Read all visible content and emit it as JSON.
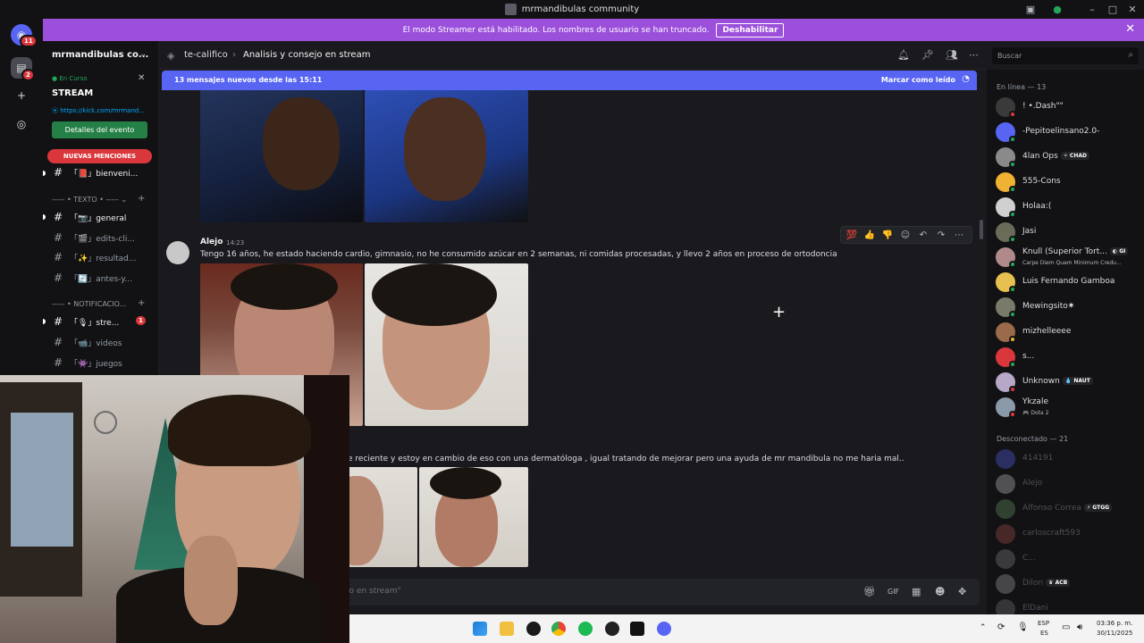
{
  "window": {
    "title": "mrmandibulas community",
    "controls": [
      "–",
      "□",
      "✕"
    ]
  },
  "streamer_banner": {
    "text": "El modo Streamer está habilitado. Los nombres de usuario se han truncado.",
    "button": "Deshabilitar"
  },
  "rail": {
    "badge_top": "11",
    "badge_second": "2"
  },
  "sidebar": {
    "server_name": "mrmandibulas co...",
    "event": {
      "status": "En Curso",
      "title": "STREAM",
      "link": "https://kick.com/mrmand...",
      "button": "Detalles del evento"
    },
    "mentions_label": "NUEVAS MENCIONES",
    "channels_top": [
      {
        "label": "「📕」bienveni..."
      }
    ],
    "category_text": "----- • TEXTO • -----",
    "text_channels": [
      {
        "label": "「📷」general"
      },
      {
        "label": "「🎬」edits-cli..."
      },
      {
        "label": "「✨」resultad..."
      },
      {
        "label": "「🔄」antes-y..."
      }
    ],
    "category_notif": "----- • NOTIFICACIO...",
    "notif_channels": [
      {
        "label": "「🎙」stre...",
        "badge": "1"
      },
      {
        "label": "「📹」videos"
      },
      {
        "label": "「👾」juegos"
      }
    ]
  },
  "header": {
    "parent": "te-califico",
    "current": "Analisis y consejo en stream"
  },
  "search": {
    "placeholder": "Buscar"
  },
  "new_messages": {
    "text": "13 mensajes nuevos desde las 15:11",
    "action": "Marcar como leído"
  },
  "message": {
    "author": "Alejo",
    "time": "14:23",
    "text": "Tengo 16 años, he estado haciendo cardio, gimnasio, no he consumido azúcar en 2 semanas, ni comidas procesadas, y llevo 2 años en proceso de ortodoncia",
    "text2": "e reciente y estoy en cambio de eso con una dermatóloga , igual tratando de mejorar pero una ayuda de mr mandibula no me haria mal..",
    "reactions": [
      "💯",
      "👍",
      "👎"
    ]
  },
  "input": {
    "placeholder": "lejo en stream\""
  },
  "members": {
    "online_header": "En línea — 13",
    "online": [
      {
        "name": "! •.Dash\"\"",
        "color": "#3a3a3a",
        "status": "#da373c"
      },
      {
        "name": "-Pepitoelinsano2.0-",
        "color": "#5865f2",
        "status": "#23a55a"
      },
      {
        "name": "4lan Ops",
        "tag": "✧ CHAD",
        "color": "#8a8a8a",
        "status": "#23a55a"
      },
      {
        "name": "555-Cons",
        "color": "#f0b232",
        "status": "#23a55a"
      },
      {
        "name": "Holaa:(",
        "color": "#d0d0d0",
        "status": "#23a55a"
      },
      {
        "name": "Jasi",
        "color": "#6b6b5a",
        "status": "#23a55a"
      },
      {
        "name": "Knull (Superior Tort...",
        "tag": "◐ GI",
        "sub": "Carpe Diem Quam Minimum Credu...",
        "color": "#b08a8a",
        "status": "#23a55a"
      },
      {
        "name": "Luis Fernando Gamboa",
        "color": "#e8c050",
        "status": "#23a55a"
      },
      {
        "name": "Mewingsito✷",
        "color": "#7a7a6a",
        "status": "#23a55a"
      },
      {
        "name": "mizhelleeee",
        "color": "#9a6a4a",
        "status": "#f0b232"
      },
      {
        "name": "s...",
        "color": "#da373c",
        "status": "#23a55a"
      },
      {
        "name": "Unknown",
        "tag": "💧 NAUT",
        "color": "#b8a8c8",
        "status": "#da373c"
      },
      {
        "name": "Ykzale",
        "sub": "🎮 Dota 2",
        "color": "#8a9aa8",
        "status": "#da373c"
      }
    ],
    "offline_header": "Desconectado — 21",
    "offline": [
      {
        "name": "414191",
        "color": "#5865f2"
      },
      {
        "name": "Alejo",
        "color": "#c8c8c8"
      },
      {
        "name": "Alfonso Correa",
        "tag": "⚡ GTGG",
        "color": "#6a9a6a"
      },
      {
        "name": "carloscraft593",
        "color": "#b05050"
      },
      {
        "name": "C...",
        "color": "#888888"
      },
      {
        "name": "Dilon",
        "tag": "♛ ACB",
        "color": "#aaaaaa"
      },
      {
        "name": "ElDani",
        "color": "#777777"
      }
    ]
  },
  "taskbar": {
    "lang1": "ESP",
    "lang2": "ES",
    "time": "03:36 p. m.",
    "date": "30/11/2025"
  }
}
